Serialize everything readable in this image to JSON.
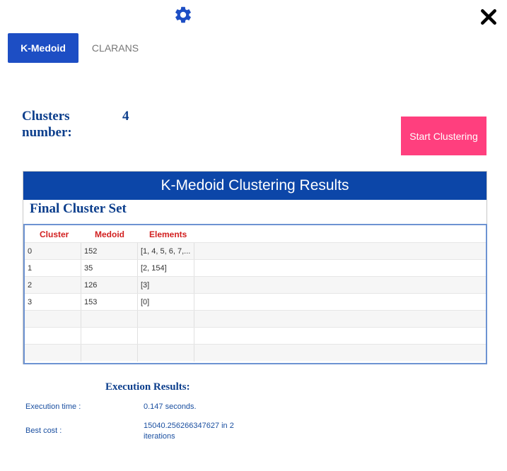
{
  "icons": {
    "settings": "gear-icon",
    "close": "close-icon"
  },
  "tabs": [
    {
      "label": "K-Medoid",
      "active": true
    },
    {
      "label": "CLARANS",
      "active": false
    }
  ],
  "config": {
    "clusters_label_line1": "Clusters",
    "clusters_label_line2": "number:",
    "clusters_value": "4",
    "start_button": "Start Clustering"
  },
  "results": {
    "header": "K-Medoid Clustering Results",
    "subtitle": "Final Cluster Set",
    "columns": [
      "Cluster",
      "Medoid",
      "Elements"
    ],
    "rows": [
      [
        "0",
        "152",
        "[1, 4, 5, 6, 7,..."
      ],
      [
        "1",
        "35",
        "[2, 154]"
      ],
      [
        "2",
        "126",
        "[3]"
      ],
      [
        "3",
        "153",
        "[0]"
      ],
      [
        "",
        "",
        ""
      ],
      [
        "",
        "",
        ""
      ],
      [
        "",
        "",
        ""
      ]
    ]
  },
  "execution": {
    "title": "Execution Results:",
    "time_label": "Execution time :",
    "time_value": "0.147 seconds.",
    "cost_label": "Best cost :",
    "cost_value": "15040.256266347627 in 2 iterations"
  },
  "colors": {
    "accent": "#1d4ec4",
    "header_bg": "#0c46a8",
    "button": "#ff3f7e",
    "title_text": "#0c3e8c",
    "column_header": "#d22020"
  }
}
